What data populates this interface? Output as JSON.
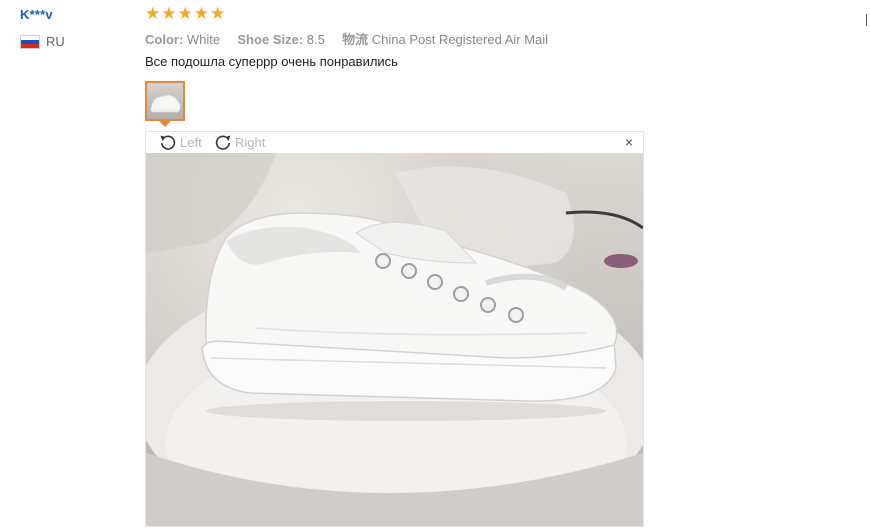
{
  "review": {
    "user_name": "K***v",
    "country_code": "RU",
    "flag_colors": [
      "#ffffff",
      "#1c4fb5",
      "#d52b1e"
    ],
    "rating": 5,
    "stars": [
      "★",
      "★",
      "★",
      "★",
      "★"
    ],
    "star_color": "#f5a623",
    "color_label": "Color:",
    "color_value": "White",
    "size_label": "Shoe Size:",
    "size_value": "8.5",
    "shipping_label": "物流",
    "shipping_value": "China Post Registered Air Mail",
    "text": "Все подошла суперрр очень понравились"
  },
  "viewer": {
    "rotate_left_label": "Left",
    "rotate_right_label": "Right",
    "close_symbol": "×"
  }
}
